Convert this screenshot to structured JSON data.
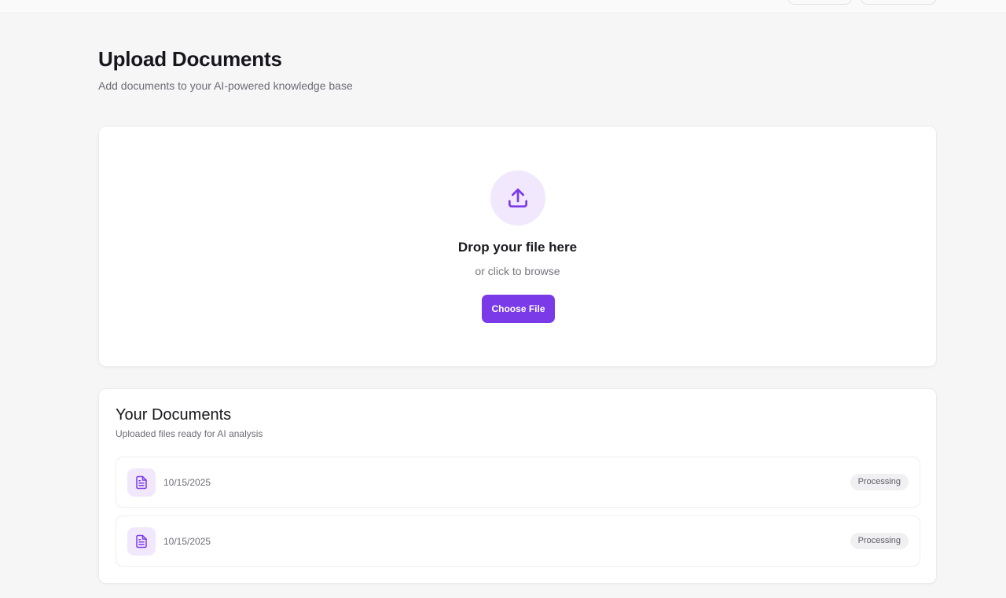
{
  "page": {
    "title": "Upload Documents",
    "subtitle": "Add documents to your AI-powered knowledge base"
  },
  "upload": {
    "icon": "upload-icon",
    "title": "Drop your file here",
    "subtitle": "or click to browse",
    "button_label": "Choose File"
  },
  "documents": {
    "title": "Your Documents",
    "subtitle": "Uploaded files ready for AI analysis",
    "items": [
      {
        "icon": "file-text-icon",
        "date": "10/15/2025",
        "status": "Processing"
      },
      {
        "icon": "file-text-icon",
        "date": "10/15/2025",
        "status": "Processing"
      }
    ]
  },
  "colors": {
    "accent": "#7a3ae8",
    "accent_soft": "#f1e8fd",
    "background": "#f6f6f7"
  }
}
